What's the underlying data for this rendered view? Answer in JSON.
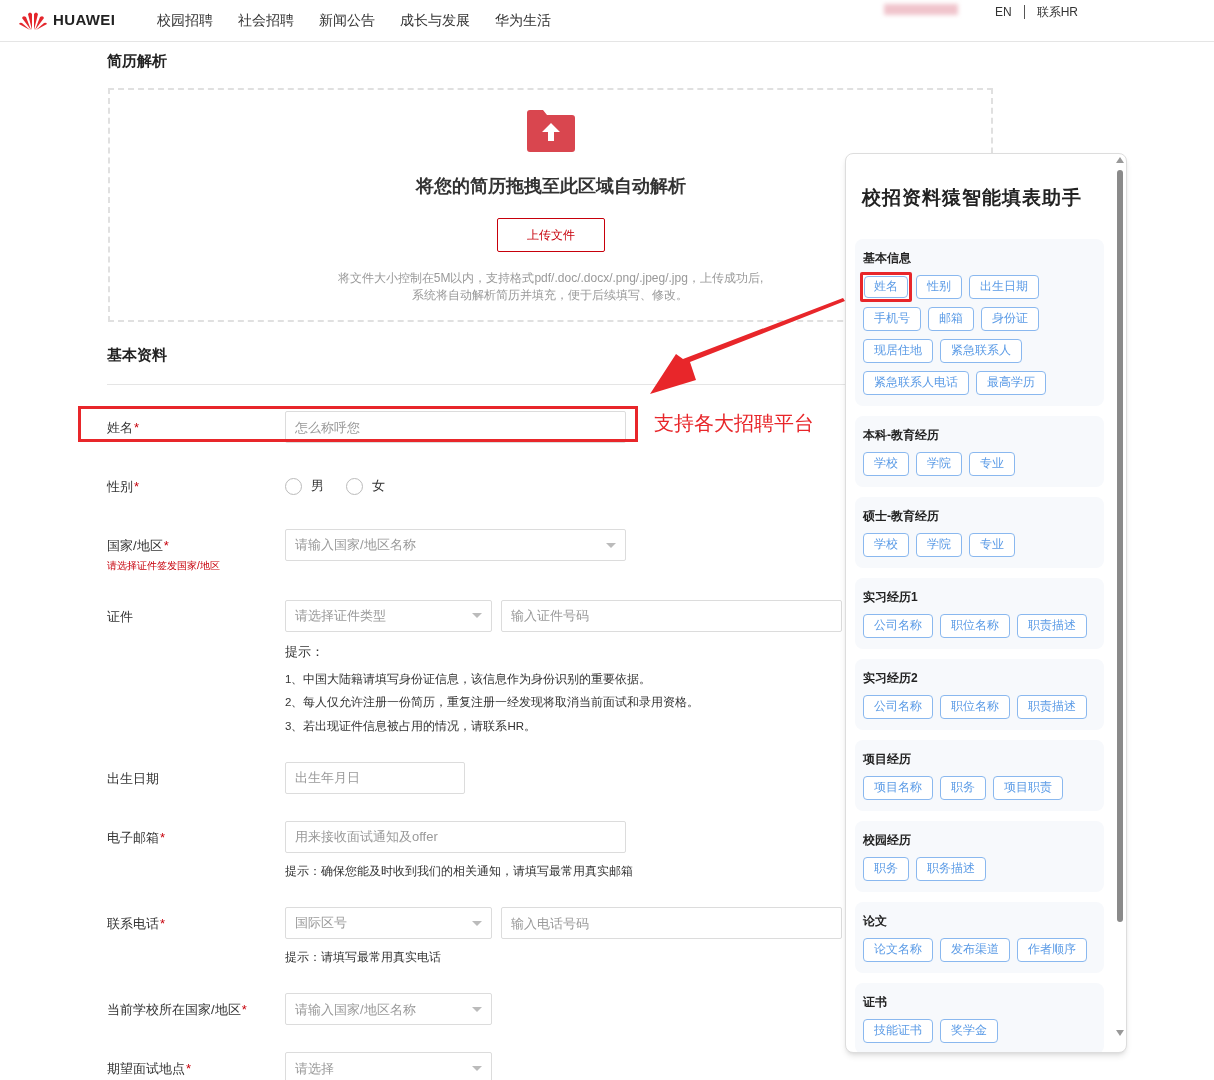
{
  "header": {
    "logo": "HUAWEI",
    "nav": [
      {
        "label": "校园招聘"
      },
      {
        "label": "社会招聘"
      },
      {
        "label": "新闻公告"
      },
      {
        "label": "成长与发展"
      },
      {
        "label": "华为生活"
      }
    ],
    "language": "EN",
    "contact": "联系HR"
  },
  "resume_parse": {
    "title": "简历解析",
    "drop_text": "将您的简历拖拽至此区域自动解析",
    "button": "上传文件",
    "hints": [
      "将文件大小控制在5M以内，支持格式pdf/.doc/.docx/.png/.jpeg/.jpg，上传成功后,",
      "系统将自动解析简历并填充，便于后续填写、修改。"
    ]
  },
  "basic_info": {
    "title": "基本资料",
    "fields": [
      {
        "kind": "text",
        "label": "姓名",
        "required_mark": "*",
        "placeholder": "怎么称呼您",
        "highlighted": true
      },
      {
        "kind": "radio",
        "label": "性别",
        "required_mark": "*",
        "options": [
          {
            "label": "男",
            "selected": false
          },
          {
            "label": "女",
            "selected": false
          }
        ]
      },
      {
        "kind": "select",
        "label": "国家/地区",
        "required_mark": "*",
        "note": "请选择证件签发国家/地区",
        "placeholder": "请输入国家/地区名称"
      },
      {
        "kind": "select_input",
        "label": "证件",
        "select_placeholder": "请选择证件类型",
        "input_placeholder": "输入证件号码",
        "tip_title": "提示：",
        "tips": [
          "1、中国大陆籍请填写身份证信息，该信息作为身份识别的重要依据。",
          "2、每人仅允许注册一份简历，重复注册一经发现将取消当前面试和录用资格。",
          "3、若出现证件信息被占用的情况，请联系HR。"
        ]
      },
      {
        "kind": "date",
        "label": "出生日期",
        "placeholder": "出生年月日"
      },
      {
        "kind": "text",
        "label": "电子邮箱",
        "required_mark": "*",
        "placeholder": "用来接收面试通知及offer",
        "tips": [
          "提示：确保您能及时收到我们的相关通知，请填写最常用真实邮箱"
        ]
      },
      {
        "kind": "select_input",
        "label": "联系电话",
        "required_mark": "*",
        "select_placeholder": "国际区号",
        "input_placeholder": "输入电话号码",
        "tips": [
          "提示：请填写最常用真实电话"
        ]
      },
      {
        "kind": "short_select",
        "label": "当前学校所在国家/地区",
        "required_mark": "*",
        "placeholder": "请输入国家/地区名称"
      },
      {
        "kind": "short_select",
        "label": "期望面试地点",
        "required_mark": "*",
        "placeholder": "请选择"
      }
    ]
  },
  "annotation": {
    "text": "支持各大招聘平台"
  },
  "assistant": {
    "title": "校招资料猿智能填表助手",
    "sections": [
      {
        "title": "基本信息",
        "chips": [
          {
            "label": "姓名",
            "highlighted": true
          },
          {
            "label": "性别",
            "highlighted": false
          },
          {
            "label": "出生日期",
            "highlighted": false
          },
          {
            "label": "手机号",
            "highlighted": false
          },
          {
            "label": "邮箱",
            "highlighted": false
          },
          {
            "label": "身份证",
            "highlighted": false
          },
          {
            "label": "现居住地",
            "highlighted": false
          },
          {
            "label": "紧急联系人",
            "highlighted": false
          },
          {
            "label": "紧急联系人电话",
            "highlighted": false
          },
          {
            "label": "最高学历",
            "highlighted": false
          }
        ]
      },
      {
        "title": "本科-教育经历",
        "chips": [
          {
            "label": "学校",
            "highlighted": false
          },
          {
            "label": "学院",
            "highlighted": false
          },
          {
            "label": "专业",
            "highlighted": false
          }
        ]
      },
      {
        "title": "硕士-教育经历",
        "chips": [
          {
            "label": "学校",
            "highlighted": false
          },
          {
            "label": "学院",
            "highlighted": false
          },
          {
            "label": "专业",
            "highlighted": false
          }
        ]
      },
      {
        "title": "实习经历1",
        "chips": [
          {
            "label": "公司名称",
            "highlighted": false
          },
          {
            "label": "职位名称",
            "highlighted": false
          },
          {
            "label": "职责描述",
            "highlighted": false
          }
        ]
      },
      {
        "title": "实习经历2",
        "chips": [
          {
            "label": "公司名称",
            "highlighted": false
          },
          {
            "label": "职位名称",
            "highlighted": false
          },
          {
            "label": "职责描述",
            "highlighted": false
          }
        ]
      },
      {
        "title": "项目经历",
        "chips": [
          {
            "label": "项目名称",
            "highlighted": false
          },
          {
            "label": "职务",
            "highlighted": false
          },
          {
            "label": "项目职责",
            "highlighted": false
          }
        ]
      },
      {
        "title": "校园经历",
        "chips": [
          {
            "label": "职务",
            "highlighted": false
          },
          {
            "label": "职务描述",
            "highlighted": false
          }
        ]
      },
      {
        "title": "论文",
        "chips": [
          {
            "label": "论文名称",
            "highlighted": false
          },
          {
            "label": "发布渠道",
            "highlighted": false
          },
          {
            "label": "作者顺序",
            "highlighted": false
          }
        ]
      },
      {
        "title": "证书",
        "chips": [
          {
            "label": "技能证书",
            "highlighted": false
          },
          {
            "label": "奖学金",
            "highlighted": false
          }
        ]
      }
    ]
  }
}
